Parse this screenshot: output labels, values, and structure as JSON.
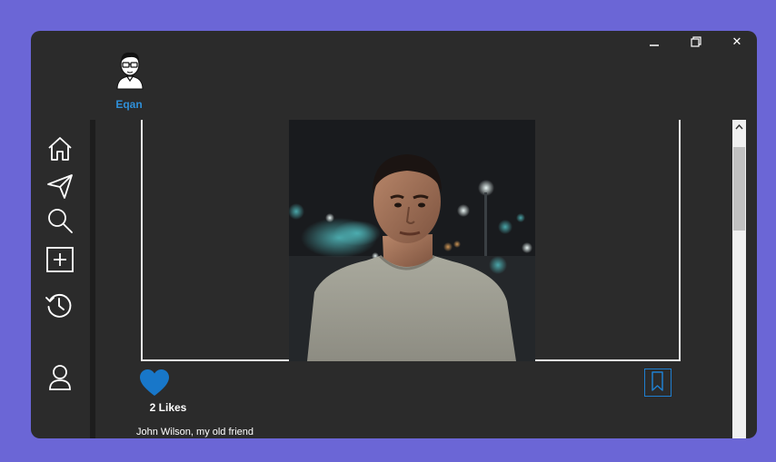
{
  "window": {
    "controls": {
      "minimize": "minimize-icon",
      "restore": "restore-icon",
      "close": "close-icon",
      "close_glyph": "✕"
    }
  },
  "profile": {
    "name": "Eqan",
    "avatar": "avatar-icon"
  },
  "sidebar": {
    "items": [
      {
        "icon": "home-icon"
      },
      {
        "icon": "send-icon"
      },
      {
        "icon": "search-icon"
      },
      {
        "icon": "add-post-icon"
      },
      {
        "icon": "history-icon"
      },
      {
        "icon": "user-icon"
      }
    ]
  },
  "post": {
    "likes": "2 Likes",
    "caption": "John Wilson, my old friend",
    "liked": true
  },
  "colors": {
    "background": "#6b66d6",
    "window": "#2b2b2b",
    "accent": "#1f7fd0",
    "username": "#2f8fd8"
  }
}
